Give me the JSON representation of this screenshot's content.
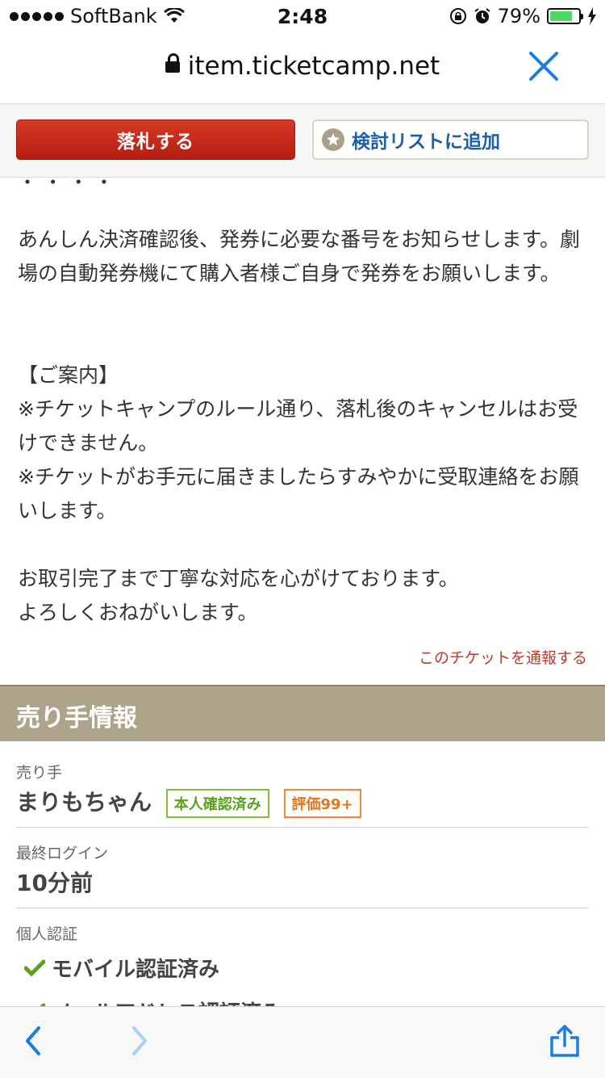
{
  "status_bar": {
    "carrier": "SoftBank",
    "time": "2:48",
    "battery_pct": "79%",
    "battery_level": 0.79
  },
  "browser": {
    "url": "item.ticketcamp.net"
  },
  "actions": {
    "bid_label": "落札する",
    "watch_label": "検討リストに追加"
  },
  "description": {
    "cut_line": "・ (スクロール途中)",
    "paragraph1": "あんしん決済確認後、発券に必要な番号をお知らせします。劇場の自動発券機にて購入者様ご自身で発券をお願いします。",
    "notice_title": "【ご案内】",
    "notice1": "※チケットキャンプのルール通り、落札後のキャンセルはお受けできません。",
    "notice2": "※チケットがお手元に届きましたらすみやかに受取連絡をお願いします。",
    "closing1": "お取引完了まで丁寧な対応を心がけております。",
    "closing2": "よろしくおねがいします。",
    "report_link": "このチケットを通報する"
  },
  "seller": {
    "section_title": "売り手情報",
    "seller_label": "売り手",
    "seller_name": "まりもちゃん",
    "badge_verified": "本人確認済み",
    "badge_rating": "評価99+",
    "last_login_label": "最終ログイン",
    "last_login_value": "10分前",
    "auth_label": "個人認証",
    "auth_items": [
      "モバイル認証済み",
      "メールアドレス認証済み"
    ]
  },
  "colors": {
    "accent_red": "#c0392b",
    "section_header": "#ada48b",
    "link_blue": "#1b5fa6",
    "ios_blue": "#1a7ee0"
  }
}
